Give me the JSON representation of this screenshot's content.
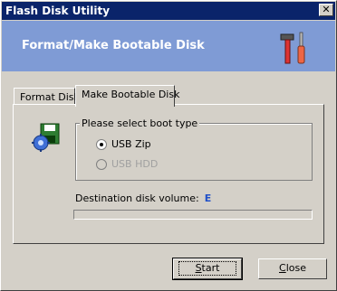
{
  "window": {
    "title": "Flash Disk Utility",
    "close_glyph": "✕"
  },
  "banner": {
    "heading": "Format/Make Bootable Disk",
    "icon": "tools-icon"
  },
  "tabs": [
    {
      "label": "Format Disk",
      "active": false
    },
    {
      "label": "Make Bootable Disk",
      "active": true
    }
  ],
  "boot_type": {
    "group_label": "Please select boot type",
    "options": [
      {
        "label": "USB Zip",
        "selected": true,
        "enabled": true
      },
      {
        "label": "USB HDD",
        "selected": false,
        "enabled": false
      }
    ]
  },
  "destination": {
    "label": "Destination disk volume:",
    "value": "E"
  },
  "progress": {
    "value": 0
  },
  "buttons": {
    "start": {
      "first": "S",
      "rest": "tart"
    },
    "close": {
      "first": "C",
      "rest": "lose"
    }
  },
  "colors": {
    "titlebar": "#0a246a",
    "banner": "#7f9bd5",
    "window": "#d4d0c8",
    "drive_letter": "#2050c8"
  }
}
